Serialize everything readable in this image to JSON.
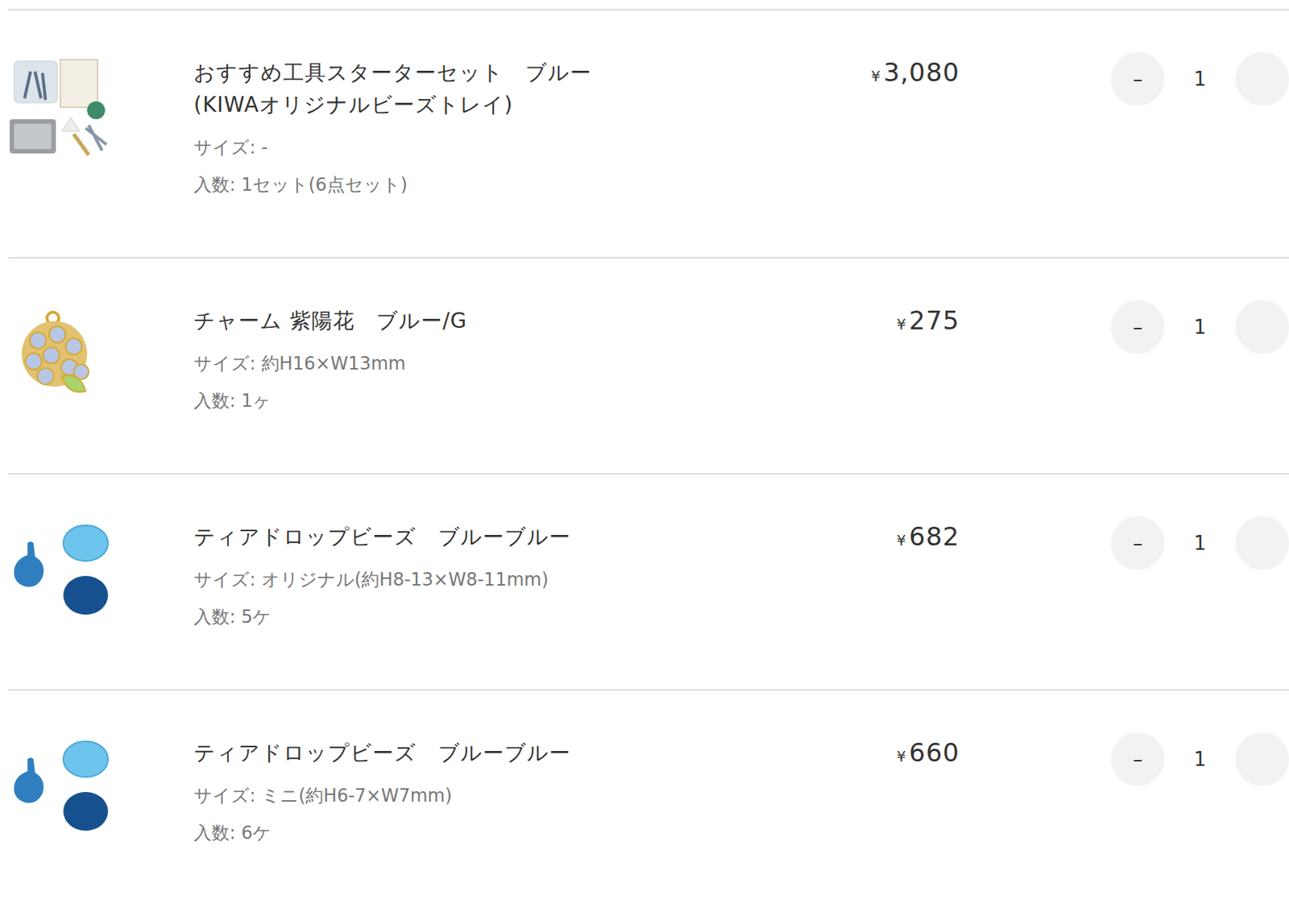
{
  "cart": {
    "items": [
      {
        "kind": "tools",
        "name_lines": [
          "おすすめ工具スターターセット　ブルー",
          "(KIWAオリジナルビーズトレイ)"
        ],
        "size": "サイズ: -",
        "count": "入数: 1セット(6点セット)",
        "currency": "¥",
        "price": "3,080",
        "quantity": "1",
        "minus": "–"
      },
      {
        "kind": "charm",
        "name_lines": [
          "チャーム 紫陽花　ブルー/G"
        ],
        "size": "サイズ: 約H16×W13mm",
        "count": "入数: 1ヶ",
        "currency": "¥",
        "price": "275",
        "quantity": "1",
        "minus": "–"
      },
      {
        "kind": "beads",
        "name_lines": [
          "ティアドロップビーズ　ブルーブルー"
        ],
        "size": "サイズ: オリジナル(約H8-13×W8-11mm)",
        "count": "入数: 5ケ",
        "currency": "¥",
        "price": "682",
        "quantity": "1",
        "minus": "–"
      },
      {
        "kind": "beads",
        "name_lines": [
          "ティアドロップビーズ　ブルーブルー"
        ],
        "size": "サイズ: ミニ(約H6-7×W7mm)",
        "count": "入数: 6ケ",
        "currency": "¥",
        "price": "660",
        "quantity": "1",
        "minus": "–"
      }
    ]
  }
}
